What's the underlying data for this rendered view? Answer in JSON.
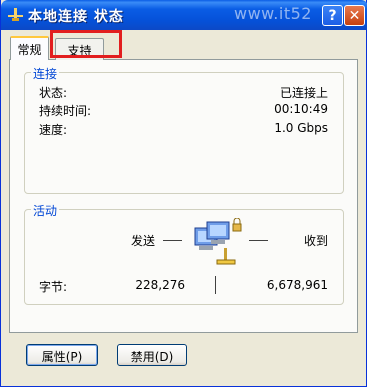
{
  "window": {
    "title": "本地连接 状态",
    "watermark": "www.it52",
    "help_button": "?",
    "close_button": "✕"
  },
  "tabs": [
    {
      "label": "常规",
      "selected": true
    },
    {
      "label": "支持",
      "selected": false
    }
  ],
  "connection": {
    "group_title": "连接",
    "rows": [
      {
        "label": "状态:",
        "value": "已连接上"
      },
      {
        "label": "持续时间:",
        "value": "00:10:49"
      },
      {
        "label": "速度:",
        "value": "1.0 Gbps"
      }
    ]
  },
  "activity": {
    "group_title": "活动",
    "sent_label": "发送",
    "received_label": "收到",
    "bytes_label": "字节:",
    "bytes_sent": "228,276",
    "bytes_received": "6,678,961"
  },
  "buttons": {
    "properties": "属性(P)",
    "disable": "禁用(D)"
  },
  "colors": {
    "titlebar": "#0a5de5",
    "group_title": "#0046d5",
    "highlight_box": "#e21e1e"
  }
}
